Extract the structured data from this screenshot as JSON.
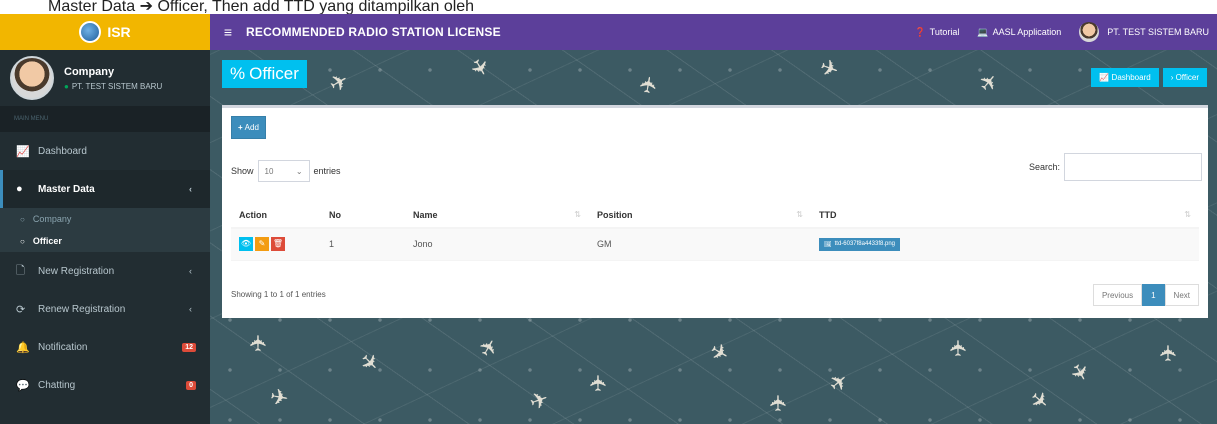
{
  "caption": "Master Data ➔ Officer, Then add TTD yang ditampilkan oleh",
  "brand": {
    "logo_text": "ISR"
  },
  "user": {
    "name": "Company",
    "company": "PT. TEST SISTEM BARU"
  },
  "nav": {
    "header": "MAIN MENU",
    "items": [
      {
        "label": "Dashboard",
        "icon": "chart-line-icon"
      },
      {
        "label": "Master Data",
        "icon": "circle-icon",
        "caret": "‹"
      },
      {
        "label": "New Registration",
        "icon": "file-icon",
        "caret": "‹"
      },
      {
        "label": "Renew Registration",
        "icon": "refresh-icon",
        "caret": "‹"
      },
      {
        "label": "Notification",
        "icon": "bell-icon",
        "badge": "12"
      },
      {
        "label": "Chatting",
        "icon": "comments-icon",
        "badge": "0"
      }
    ],
    "submenu": [
      {
        "label": "Company"
      },
      {
        "label": "Officer"
      }
    ]
  },
  "topbar": {
    "title": "RECOMMENDED RADIO STATION LICENSE",
    "tutorial": "Tutorial",
    "aasl": "AASL Application",
    "user": "PT. TEST SISTEM BARU"
  },
  "content": {
    "title": "Officer",
    "breadcrumb": [
      "Dashboard",
      "Officer"
    ]
  },
  "box": {
    "add_label": "Add",
    "show_label": "Show",
    "entries_label": "entries",
    "length_value": "10",
    "search_label": "Search:",
    "columns": [
      "Action",
      "No",
      "Name",
      "Position",
      "TTD"
    ],
    "rows": [
      {
        "no": "1",
        "name": "Jono",
        "position": "GM",
        "ttd": "ttd-6037f8a4433f8.png"
      }
    ],
    "info": "Showing 1 to 1 of 1 entries",
    "pagination": {
      "previous": "Previous",
      "current": "1",
      "next": "Next"
    }
  }
}
